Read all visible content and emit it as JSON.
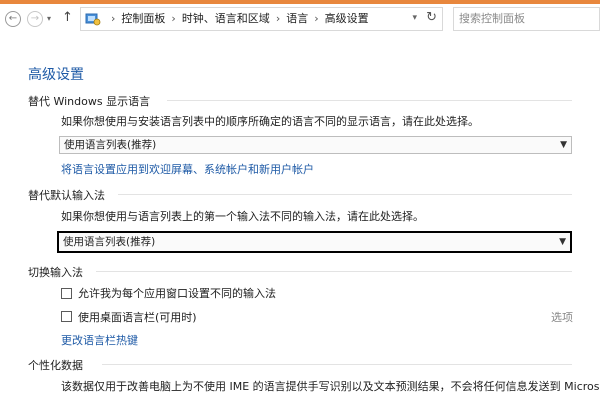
{
  "nav": {
    "breadcrumbs": [
      "控制面板",
      "时钟、语言和区域",
      "语言",
      "高级设置"
    ],
    "breadcrumb_separator": "›",
    "search_placeholder": "搜索控制面板"
  },
  "page": {
    "title": "高级设置"
  },
  "sections": {
    "display_language": {
      "heading": "替代 Windows 显示语言",
      "description": "如果你想使用与安装语言列表中的顺序所确定的语言不同的显示语言，请在此处选择。",
      "select_value": "使用语言列表(推荐)",
      "apply_link": "将语言设置应用到欢迎屏幕、系统帐户和新用户帐户"
    },
    "input_method": {
      "heading": "替代默认输入法",
      "description": "如果你想使用与语言列表上的第一个输入法不同的输入法，请在此处选择。",
      "select_value": "使用语言列表(推荐)"
    },
    "switch_input": {
      "heading": "切换输入法",
      "checkbox1_label": "允许我为每个应用窗口设置不同的输入法",
      "checkbox1_checked": false,
      "checkbox2_label": "使用桌面语言栏(可用时)",
      "checkbox2_checked": false,
      "options_label": "选项",
      "hotkeys_link": "更改语言栏热键"
    },
    "personalization": {
      "heading": "个性化数据",
      "description_partial": "该数据仅用于改善电脑上为不使用 IME 的语言提供手写识别以及文本预测结果，不会将任何信息发送到 Microsoft"
    }
  },
  "colors": {
    "accent_strip": "#e8873d",
    "link": "#1e5aa6",
    "title": "#1e5aa6"
  }
}
